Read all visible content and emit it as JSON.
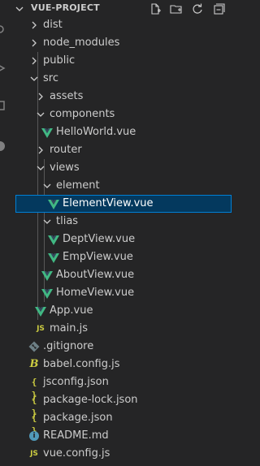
{
  "explorer": {
    "title": "VUE-PROJECT"
  },
  "header_actions": {
    "icons": [
      "new-file-icon",
      "new-folder-icon",
      "refresh-icon",
      "collapse-all-icon"
    ]
  },
  "colors": {
    "background": "#252526",
    "text": "#cccccc",
    "selected_background": "#04395e",
    "selected_border": "#007fd4",
    "vue_green": "#41b883",
    "js_yellow": "#cbcb41",
    "info_blue": "#519aba",
    "gitignore_gray": "#6d8086"
  },
  "tree": {
    "dist": "dist",
    "node_modules": "node_modules",
    "public": "public",
    "src": "src",
    "assets": "assets",
    "components": "components",
    "helloworld": "HelloWorld.vue",
    "router": "router",
    "views": "views",
    "element": "element",
    "elementview": "ElementView.vue",
    "tlias": "tlias",
    "deptview": "DeptView.vue",
    "empview": "EmpView.vue",
    "aboutview": "AboutView.vue",
    "homeview": "HomeView.vue",
    "app": "App.vue",
    "main": "main.js",
    "gitignore": ".gitignore",
    "babel": "babel.config.js",
    "jsconfig": "jsconfig.json",
    "packagelock": "package-lock.json",
    "package": "package.json",
    "readme": "README.md",
    "vueconfig": "vue.config.js"
  },
  "icon_glyphs": {
    "js": "JS",
    "json": "{ }",
    "babel": "B",
    "info": "i"
  },
  "selected_item": "ElementView.vue"
}
